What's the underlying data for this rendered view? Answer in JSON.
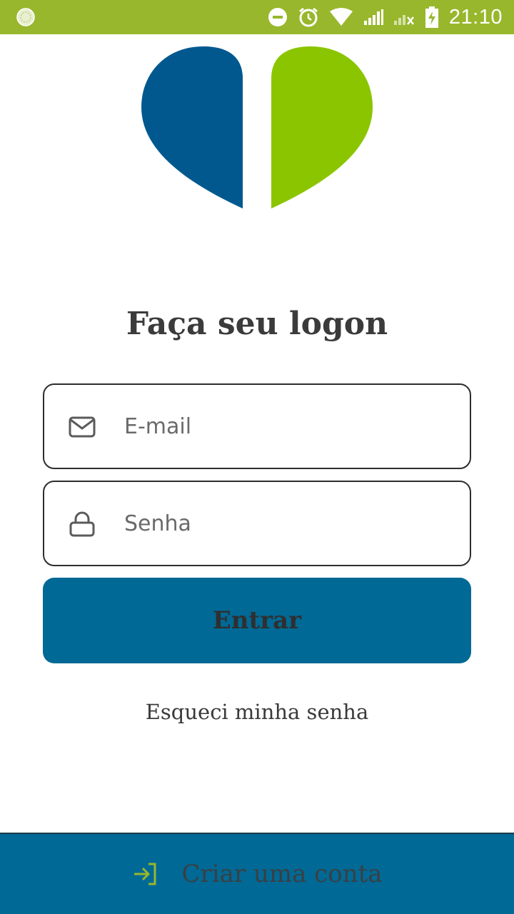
{
  "status_bar": {
    "time": "21:10",
    "icons": [
      "app-notification-icon",
      "do-not-disturb-icon",
      "alarm-icon",
      "wifi-icon",
      "signal-icon",
      "no-signal-icon",
      "battery-charging-icon"
    ],
    "background": "#98b72c"
  },
  "logo": {
    "icon": "split-heart-logo",
    "left_color": "#01588f",
    "right_color": "#8bc500"
  },
  "login": {
    "title": "Faça seu logon",
    "email_placeholder": "E-mail",
    "email_value": "",
    "password_placeholder": "Senha",
    "password_value": "",
    "submit_label": "Entrar",
    "forgot_label": "Esqueci minha senha"
  },
  "footer": {
    "create_account_label": "Criar uma conta",
    "icon": "sign-in-icon",
    "background": "#016995",
    "icon_color": "#98b72c"
  }
}
